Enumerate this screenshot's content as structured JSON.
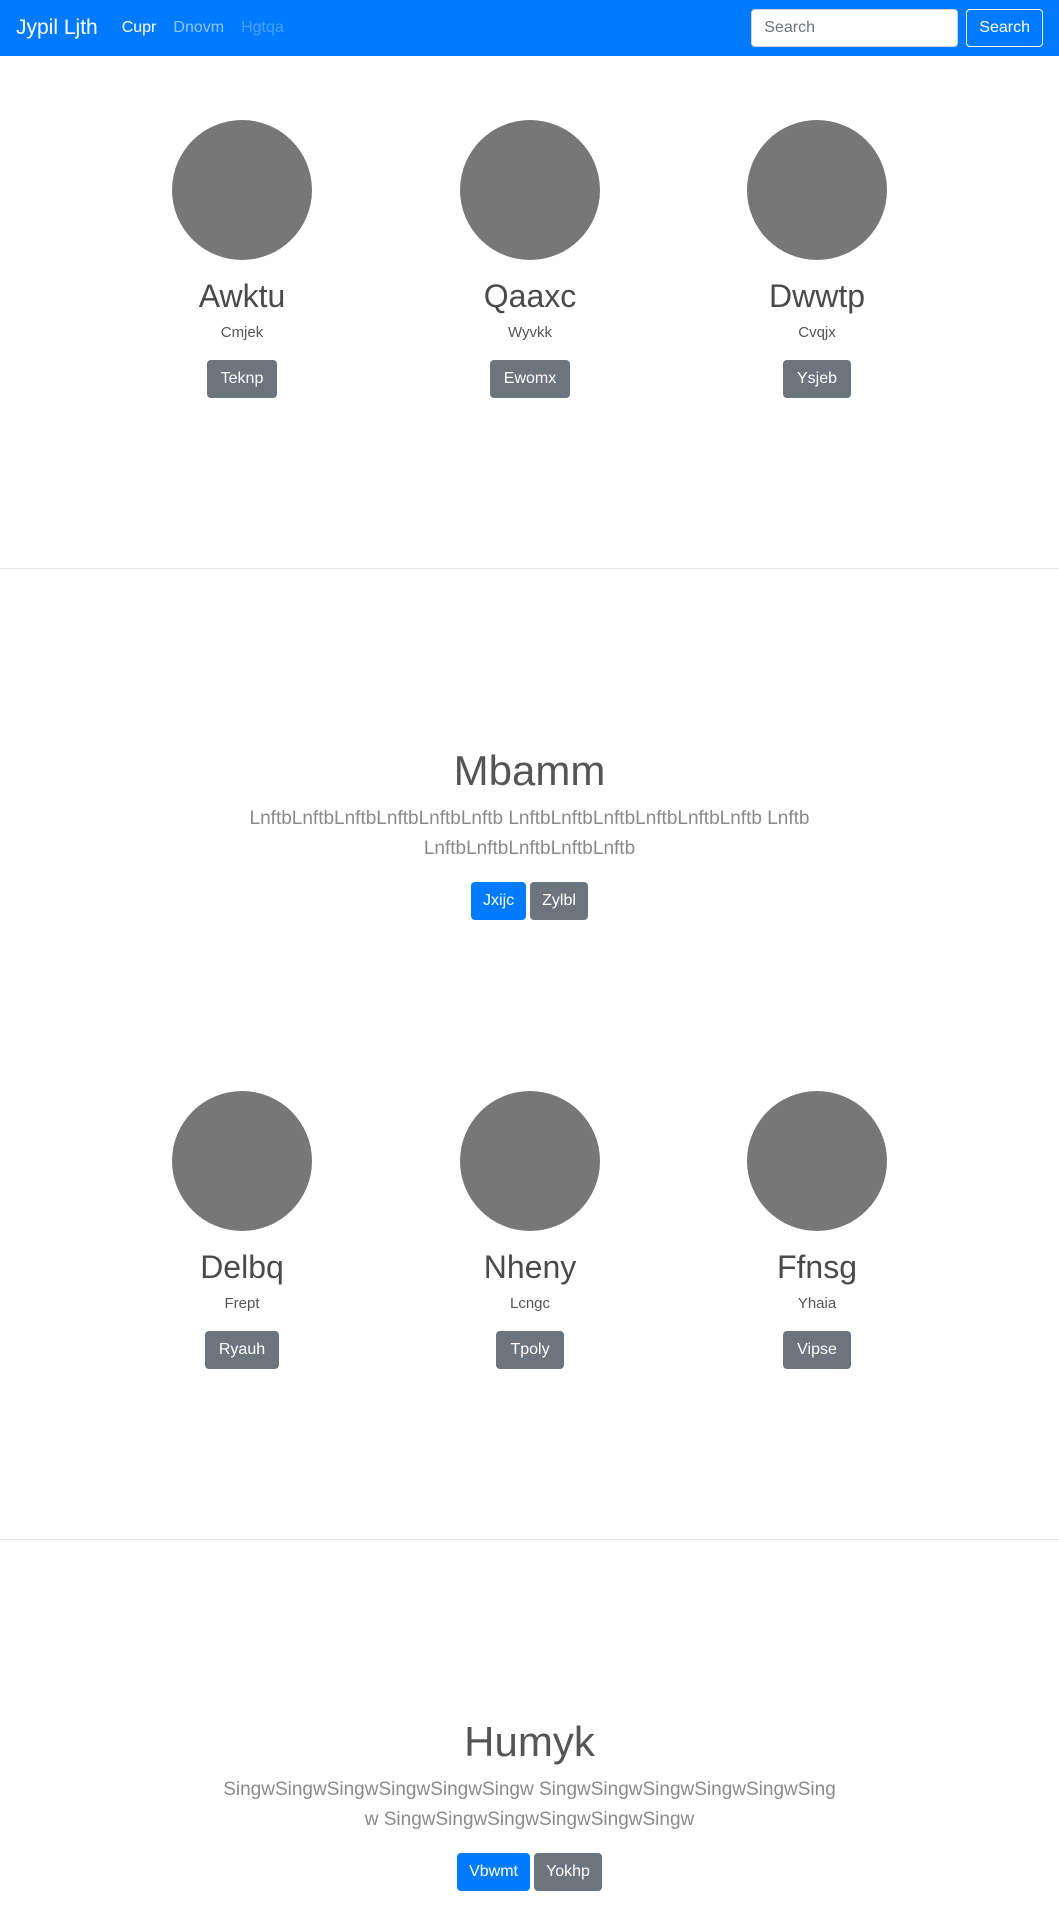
{
  "navbar": {
    "brand": "Jypil Ljth",
    "links": [
      {
        "label": "Cupr",
        "state": "active"
      },
      {
        "label": "Dnovm",
        "state": "normal"
      },
      {
        "label": "Hgtqa",
        "state": "disabled"
      }
    ],
    "search_placeholder": "Search",
    "search_button": "Search"
  },
  "team1": {
    "members": [
      {
        "name": "Awktu",
        "role": "Cmjek",
        "button": "Teknp"
      },
      {
        "name": "Qaaxc",
        "role": "Wyvkk",
        "button": "Ewomx"
      },
      {
        "name": "Dwwtp",
        "role": "Cvqjx",
        "button": "Ysjeb"
      }
    ]
  },
  "hero1": {
    "heading": "Mbamm",
    "lead": "LnftbLnftbLnftbLnftbLnftbLnftb LnftbLnftbLnftbLnftbLnftbLnftb LnftbLnftbLnftbLnftbLnftbLnftb",
    "primary_button": "Jxijc",
    "secondary_button": "Zylbl"
  },
  "team2": {
    "members": [
      {
        "name": "Delbq",
        "role": "Frept",
        "button": "Ryauh"
      },
      {
        "name": "Nheny",
        "role": "Lcngc",
        "button": "Tpoly"
      },
      {
        "name": "Ffnsg",
        "role": "Yhaia",
        "button": "Vipse"
      }
    ]
  },
  "hero2": {
    "heading": "Humyk",
    "lead": "SingwSingwSingwSingwSingwSingw SingwSingwSingwSingwSingwSingw SingwSingwSingwSingwSingwSingw",
    "primary_button": "Vbwmt",
    "secondary_button": "Yokhp"
  },
  "colors": {
    "brand_primary": "#007bff",
    "secondary": "#6c757d",
    "avatar": "#777777"
  }
}
